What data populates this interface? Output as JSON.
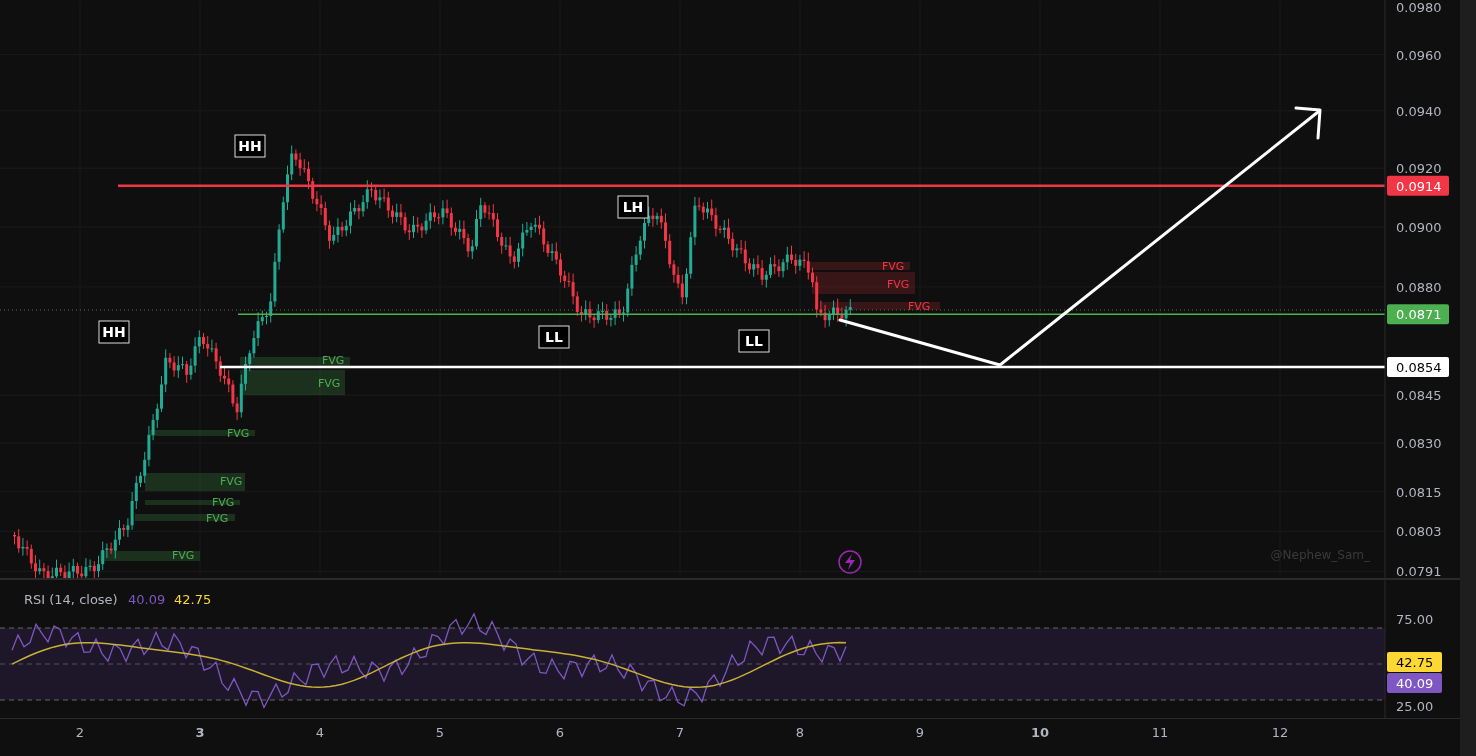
{
  "price_axis": {
    "ticks": [
      "0.0980",
      "0.0960",
      "0.0940",
      "0.0920",
      "0.0900",
      "0.0880",
      "0.0845",
      "0.0830",
      "0.0815",
      "0.0803",
      "0.0791"
    ],
    "badges": [
      {
        "label": "0.0914",
        "color": "#f23645"
      },
      {
        "label": "0.0871",
        "color": "#4caf50"
      },
      {
        "label": "0.0854",
        "color": "#ffffff"
      }
    ]
  },
  "structure_labels": [
    "HH",
    "HH",
    "LH",
    "LL",
    "LL"
  ],
  "fvg_zones": [
    {
      "label": "FVG",
      "kind": "bullish"
    },
    {
      "label": "FVG",
      "kind": "bullish"
    },
    {
      "label": "FVG",
      "kind": "bullish"
    },
    {
      "label": "FVG",
      "kind": "bullish"
    },
    {
      "label": "FVG",
      "kind": "bullish"
    },
    {
      "label": "FVG",
      "kind": "bullish"
    },
    {
      "label": "FVG",
      "kind": "bullish"
    },
    {
      "label": "FVG",
      "kind": "bearish"
    },
    {
      "label": "FVG",
      "kind": "bearish"
    },
    {
      "label": "FVG",
      "kind": "bearish"
    }
  ],
  "watermark": "@Nephew_Sam_",
  "rsi": {
    "title": "RSI (14, close)",
    "value": "40.09",
    "ma_value": "42.75",
    "ticks": [
      "75.00",
      "25.00"
    ],
    "badges": [
      {
        "label": "42.75",
        "color": "#fdd835"
      },
      {
        "label": "40.09",
        "color": "#7e57c2"
      }
    ]
  },
  "time_axis": [
    {
      "label": "2",
      "bold": false
    },
    {
      "label": "3",
      "bold": true
    },
    {
      "label": "4",
      "bold": false
    },
    {
      "label": "5",
      "bold": false
    },
    {
      "label": "6",
      "bold": false
    },
    {
      "label": "7",
      "bold": false
    },
    {
      "label": "8",
      "bold": false
    },
    {
      "label": "9",
      "bold": false
    },
    {
      "label": "10",
      "bold": true
    },
    {
      "label": "11",
      "bold": false
    },
    {
      "label": "12",
      "bold": false
    }
  ]
}
